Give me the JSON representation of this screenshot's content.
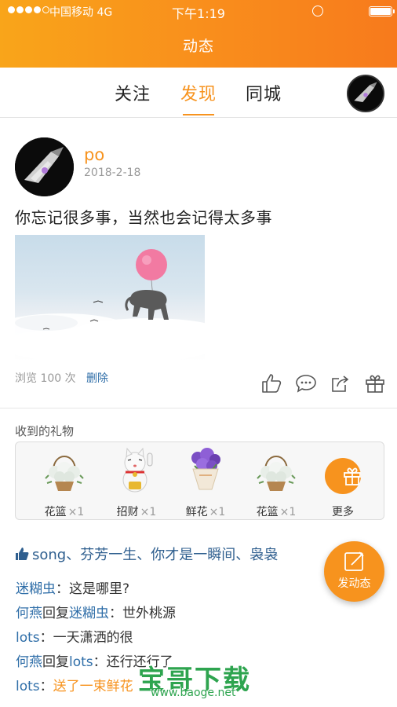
{
  "status_bar": {
    "carrier": "中国移动 4G",
    "time": "下午1:19",
    "signal_bars_filled": 4,
    "signal_bars_total": 5
  },
  "header": {
    "title": "动态"
  },
  "tabs": [
    {
      "label": "关注",
      "active": false
    },
    {
      "label": "发现",
      "active": true
    },
    {
      "label": "同城",
      "active": false
    }
  ],
  "post": {
    "username": "po",
    "date": "2018-2-18",
    "text": "你忘记很多事，当然也会记得太多事",
    "views": "浏览 100 次",
    "delete_label": "删除",
    "actions": [
      "like-icon",
      "comment-icon",
      "share-icon",
      "gift-icon"
    ]
  },
  "gifts": {
    "title": "收到的礼物",
    "items": [
      {
        "name": "花篮",
        "count": "×1",
        "icon": "flower-basket-icon"
      },
      {
        "name": "招财",
        "count": "×1",
        "icon": "lucky-cat-icon"
      },
      {
        "name": "鲜花",
        "count": "×1",
        "icon": "bouquet-icon"
      },
      {
        "name": "花篮",
        "count": "×1",
        "icon": "flower-basket-icon"
      }
    ],
    "more_label": "更多"
  },
  "likes": {
    "users": [
      "song",
      "芬芳一生",
      "你才是一瞬间",
      "袅袅"
    ],
    "separator": "、"
  },
  "comments": [
    {
      "name": "迷糊虫",
      "reply_word": "",
      "target": "",
      "colon": "：",
      "text": "这是哪里?",
      "gift_text": ""
    },
    {
      "name": "何燕",
      "reply_word": "回复",
      "target": "迷糊虫",
      "colon": "：",
      "text": "世外桃源",
      "gift_text": ""
    },
    {
      "name": "lots",
      "reply_word": "",
      "target": "",
      "colon": "：",
      "text": "一天潇洒的很",
      "gift_text": ""
    },
    {
      "name": "何燕",
      "reply_word": "回复",
      "target": "lots",
      "colon": "：",
      "text": "还行还行了",
      "gift_text": ""
    },
    {
      "name": "lots",
      "reply_word": "",
      "target": "",
      "colon": "：",
      "text": "",
      "gift_text": "送了一束鲜花"
    }
  ],
  "fab": {
    "label": "发动态"
  },
  "watermark": {
    "main": "宝哥下载",
    "sub": "www.baoge.net"
  },
  "colors": {
    "accent": "#f7931e",
    "link": "#2f6ea8",
    "watermark": "#2ea44f"
  }
}
